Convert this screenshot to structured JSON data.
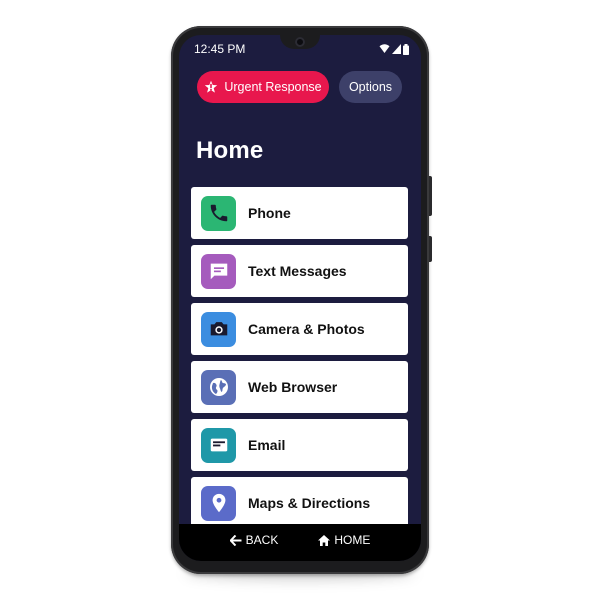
{
  "status_bar": {
    "time": "12:45 PM",
    "icons": [
      "wifi-icon",
      "signal-icon",
      "battery-icon"
    ]
  },
  "header": {
    "urgent_label": "Urgent Response",
    "options_label": "Options"
  },
  "page": {
    "title": "Home"
  },
  "apps": [
    {
      "label": "Phone",
      "icon": "phone-icon",
      "color": "#2bb673"
    },
    {
      "label": "Text Messages",
      "icon": "message-icon",
      "color": "#a55bbd"
    },
    {
      "label": "Camera & Photos",
      "icon": "camera-icon",
      "color": "#3b8de0"
    },
    {
      "label": "Web Browser",
      "icon": "globe-icon",
      "color": "#5a6fb6"
    },
    {
      "label": "Email",
      "icon": "email-icon",
      "color": "#1f98a8"
    },
    {
      "label": "Maps & Directions",
      "icon": "map-pin-icon",
      "color": "#5b6bc9"
    }
  ],
  "nav": {
    "back_label": "BACK",
    "home_label": "HOME"
  },
  "colors": {
    "screen_bg": "#1c1c3f",
    "urgent": "#e8174d",
    "options": "#3d4069"
  }
}
